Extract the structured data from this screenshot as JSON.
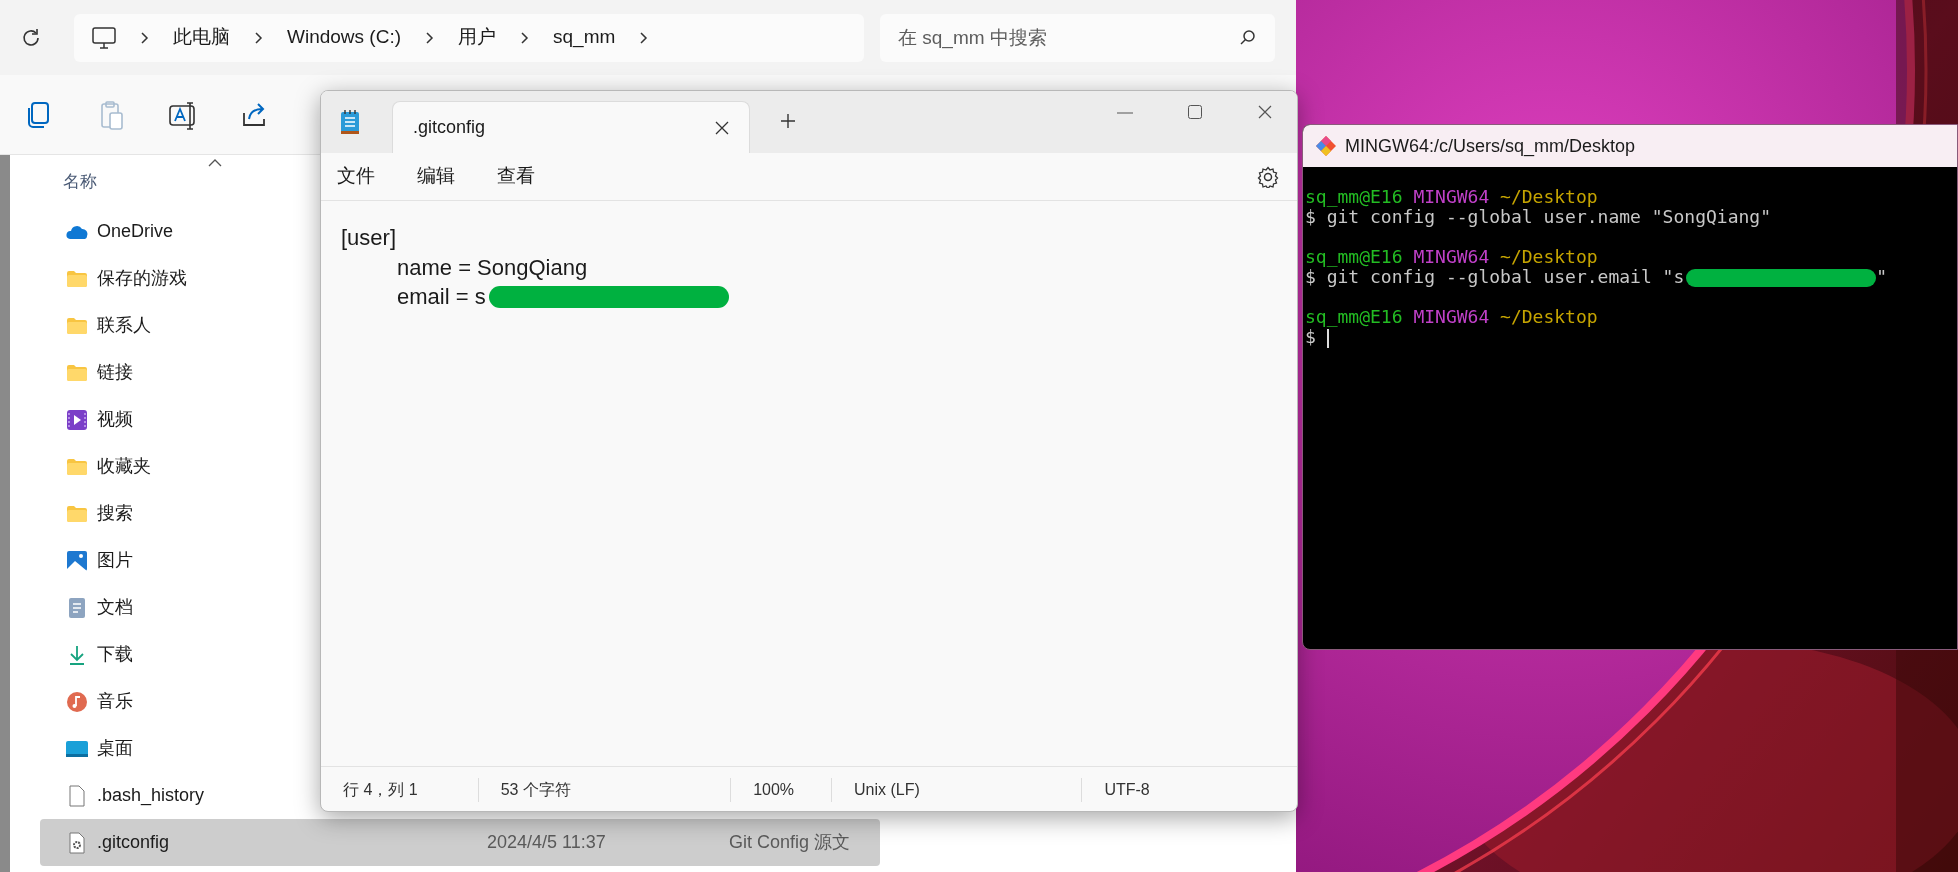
{
  "explorer": {
    "address": {
      "crumbs": [
        "此电脑",
        "Windows (C:)",
        "用户",
        "sq_mm"
      ]
    },
    "search": {
      "placeholder": "在 sq_mm 中搜索"
    },
    "toolbar": [
      {
        "kind": "copy",
        "disabled": false
      },
      {
        "kind": "paste",
        "disabled": true
      },
      {
        "kind": "rename",
        "disabled": false
      },
      {
        "kind": "share",
        "disabled": false
      }
    ],
    "column_header": "名称",
    "items": [
      {
        "name": "OneDrive",
        "kind": "cloud",
        "selected": false
      },
      {
        "name": "保存的游戏",
        "kind": "folder",
        "selected": false
      },
      {
        "name": "联系人",
        "kind": "folder",
        "selected": false
      },
      {
        "name": "链接",
        "kind": "folder",
        "selected": false
      },
      {
        "name": "视频",
        "kind": "video",
        "selected": false
      },
      {
        "name": "收藏夹",
        "kind": "folder",
        "selected": false
      },
      {
        "name": "搜索",
        "kind": "folder",
        "selected": false
      },
      {
        "name": "图片",
        "kind": "picture",
        "selected": false
      },
      {
        "name": "文档",
        "kind": "document",
        "selected": false
      },
      {
        "name": "下载",
        "kind": "download",
        "selected": false
      },
      {
        "name": "音乐",
        "kind": "music",
        "selected": false
      },
      {
        "name": "桌面",
        "kind": "desktop",
        "selected": false
      },
      {
        "name": ".bash_history",
        "kind": "file",
        "selected": false
      },
      {
        "name": ".gitconfig",
        "kind": "config",
        "selected": true,
        "date": "2024/4/5 11:37",
        "type": "Git Config 源文"
      }
    ]
  },
  "notepad": {
    "tabs": [
      {
        "title": ".gitconfig",
        "selected": true
      }
    ],
    "menu": [
      "文件",
      "编辑",
      "查看"
    ],
    "content": [
      {
        "section": "[user]",
        "entries": [
          {
            "text": "name = SongQiang",
            "redacted": false
          },
          {
            "text": "email = s",
            "redacted": true
          }
        ]
      }
    ],
    "status_bar": [
      "行 4，列 1",
      "53 个字符",
      "100%",
      "Unix (LF)",
      "UTF-8"
    ]
  },
  "terminal": {
    "title": "MINGW64:/c/Users/sq_mm/Desktop",
    "lines": [
      {
        "kind": "blank"
      },
      {
        "kind": "prompt",
        "user": "sq_mm@E16",
        "env": "MINGW64",
        "path": "~/Desktop"
      },
      {
        "kind": "command",
        "text": "$ git config --global user.name \"SongQiang\""
      },
      {
        "kind": "blank"
      },
      {
        "kind": "prompt",
        "user": "sq_mm@E16",
        "env": "MINGW64",
        "path": "~/Desktop"
      },
      {
        "kind": "command",
        "text": "$ git config --global user.email \"s",
        "redacted": true,
        "tail": "\""
      },
      {
        "kind": "blank"
      },
      {
        "kind": "prompt",
        "user": "sq_mm@E16",
        "env": "MINGW64",
        "path": "~/Desktop"
      },
      {
        "kind": "command",
        "text": "$",
        "cursor": true
      }
    ]
  }
}
